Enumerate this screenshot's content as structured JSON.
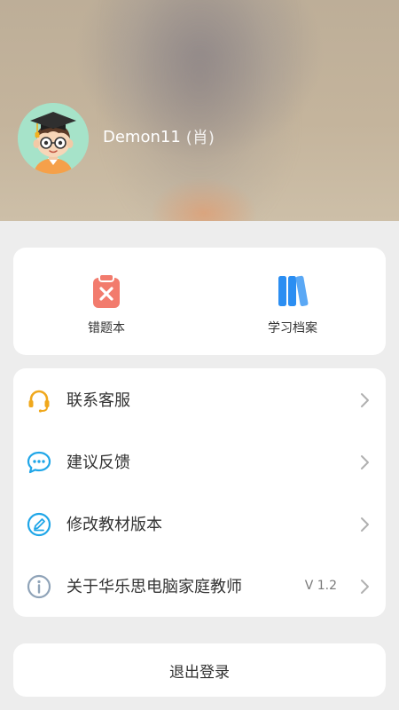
{
  "profile": {
    "name": "Demon11",
    "role": "(肖)",
    "avatar_icon": "graduate-boy-avatar"
  },
  "quick_actions": [
    {
      "label": "错题本",
      "icon": "wrong-questions-clipboard-icon",
      "color": "#f27b6d"
    },
    {
      "label": "学习档案",
      "icon": "study-records-books-icon",
      "color": "#2b8ef2"
    }
  ],
  "menu": [
    {
      "label": "联系客服",
      "icon": "headset-icon",
      "color": "#f0a81c"
    },
    {
      "label": "建议反馈",
      "icon": "chat-bubble-icon",
      "color": "#1fa6e8"
    },
    {
      "label": "修改教材版本",
      "icon": "edit-pencil-icon",
      "color": "#1fa6e8"
    },
    {
      "label": "关于华乐思电脑家庭教师",
      "icon": "info-icon",
      "color": "#8fa3b8",
      "version": "V 1.2"
    }
  ],
  "logout_label": "退出登录"
}
